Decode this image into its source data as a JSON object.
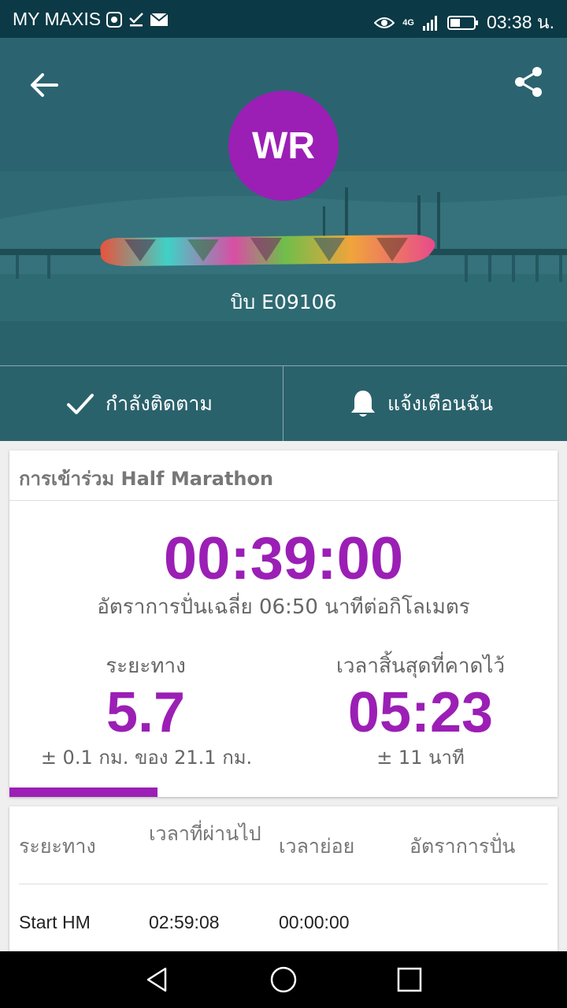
{
  "status_bar": {
    "carrier": "MY MAXIS",
    "time": "03:38 น.",
    "network": "4G"
  },
  "profile": {
    "initials": "WR",
    "bib": "บิบ E09106"
  },
  "actions": {
    "follow_label": "กำลังติดตาม",
    "notify_label": "แจ้งเตือนฉัน"
  },
  "summary": {
    "title": "การเข้าร่วม Half Marathon",
    "elapsed": "00:39:00",
    "pace_text": "อัตราการปั่นเฉลี่ย 06:50 นาทีต่อกิโลเมตร",
    "distance_label": "ระยะทาง",
    "distance_value": "5.7",
    "distance_sub": "± 0.1 กม. ของ 21.1 กม.",
    "eta_label": "เวลาสิ้นสุดที่คาดไว้",
    "eta_value": "05:23",
    "eta_sub": "± 11 นาที",
    "progress_fraction": 0.27
  },
  "splits": {
    "headers": [
      "ระยะทาง",
      "เวลาที่ผ่านไป",
      "เวลาย่อย",
      "อัตราการปั่น"
    ],
    "rows": [
      {
        "distance": "Start HM",
        "elapsed": "02:59:08",
        "split": "00:00:00",
        "pace": ""
      }
    ]
  },
  "colors": {
    "accent": "#9b1fb5",
    "status_bar": "#0b3945",
    "hero": "#2f6d77"
  },
  "icons": [
    "back-arrow-icon",
    "share-icon",
    "check-icon",
    "bell-icon",
    "eye-icon",
    "signal-icon",
    "battery-icon",
    "mail-icon",
    "nav-back-icon",
    "nav-home-icon",
    "nav-recents-icon"
  ]
}
